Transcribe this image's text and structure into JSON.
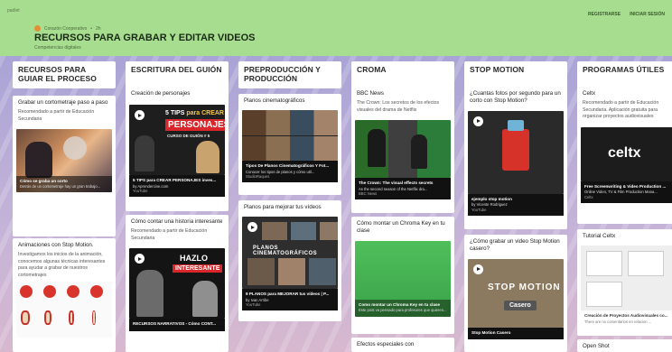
{
  "header": {
    "logo": "padlet",
    "author": "Corazón Cooperativo",
    "time": "2h",
    "title": "RECURSOS PARA GRABAR Y EDITAR VIDEOS",
    "subtitle": "Competencias digitales",
    "links": [
      "REGISTRARSE",
      "INICIAR SESIÓN"
    ],
    "colors": {
      "header_bg": "#a6dd8e",
      "board_bg": "#b3aed8"
    }
  },
  "columns": [
    {
      "heading": "RECURSOS PARA GUIAR EL PROCESO",
      "cards": [
        {
          "title": "Grabar un cortometraje paso a paso",
          "body": "Recomendado a partir de Educación Secundaria",
          "caption_title": "Cómo se graba un corto",
          "caption_desc": "Detrás de un cortometraje hay un gran trabajo..."
        },
        {
          "title": "Animaciones con Stop Motion.",
          "body": "Investigamos los inicios de la animación, conocemos algunas técnicas interesantes para ayudar a grabar de nuestros cortometrajes"
        }
      ]
    },
    {
      "heading": "ESCRITURA DEL GUIÓN",
      "cards": [
        {
          "title": "Creación de personajes",
          "thumb_top": "5 TIPS",
          "thumb_top2": "para CREAR",
          "thumb_main": "PERSONAJES",
          "thumb_sub": "CURSO DE GUIÓN # 5",
          "caption_title": "5 TIPS para CREAR PERSONAJES inves...",
          "caption_desc": "by Aprendercine.com",
          "caption_source": "YouTube"
        },
        {
          "title": "Cómo contar una historia interesante",
          "body": "Recomendado a partir de Educación Secundaria",
          "thumb_main": "HAZLO",
          "thumb_main2": "INTERESANTE",
          "caption_title": "RECURSOS NARRATIVOS - Cómo CONT..."
        }
      ]
    },
    {
      "heading": "PREPRODUCCIÓN Y PRODUCCIÓN",
      "cards": [
        {
          "title": "Planos cinematográficos",
          "caption_title": "Tipos De Planos Cinematográficos Y Fot...",
          "caption_desc": "Conocer los tipos de planos y cómo util...",
          "caption_source": "StudioRaques"
        },
        {
          "title": "Planos para mejorar tus vídeos",
          "thumb_main": "PLANOS CINEMATOGRÁFICOS",
          "caption_title": "9 PLANOS para MEJORAR tus vídeos | P...",
          "caption_desc": "by Ivan Arribe",
          "caption_source": "YouTube"
        }
      ]
    },
    {
      "heading": "CROMA",
      "cards": [
        {
          "title": "BBC News",
          "body": "The Crown: Los secretos de los efectos visuales del drama de Netflix",
          "caption_title": "The Crown: The visual effects secrets",
          "caption_desc": "As the second season of the Netflix dra...",
          "caption_source": "BBC News"
        },
        {
          "title": "Cómo montar un Chroma Key en tu clase",
          "caption_title": "Como montar un Chroma Key en tu clase",
          "caption_desc": "Este post va pensado para profesores que quieren..."
        },
        {
          "title": "Efectos especiales con"
        }
      ]
    },
    {
      "heading": "STOP MOTION",
      "cards": [
        {
          "title": "¿Cuantas fotos por segundo para un corto con Stop Motion?",
          "caption_title": "ejemplo stop motion",
          "caption_desc": "by Vicente Rodriguez",
          "caption_source": "YouTube"
        },
        {
          "title": "¿Cómo grabar un video Stop Motion casero?",
          "thumb_main": "STOP MOTION",
          "thumb_button": "Casero",
          "caption_title": "Stop Motion Casero"
        }
      ]
    },
    {
      "heading": "PROGRAMAS ÚTILES",
      "cards": [
        {
          "title": "Celtx",
          "body": "Recomendado a partir de Educación Secundaria. Aplicación gratuita para organizar proyectos audiovisuales",
          "thumb_main": "celtx",
          "caption_title": "Free Screenwriting & Video Production ...",
          "caption_desc": "Online Video, TV & Film Production Mana...",
          "caption_source": "Celtx"
        },
        {
          "title": "Tutorial Celtx",
          "caption_title": "Creación de Proyectos Audiovisuales co...",
          "caption_desc": "There are no comentarios en relacion ..."
        },
        {
          "title": "Open Shot"
        }
      ]
    }
  ]
}
